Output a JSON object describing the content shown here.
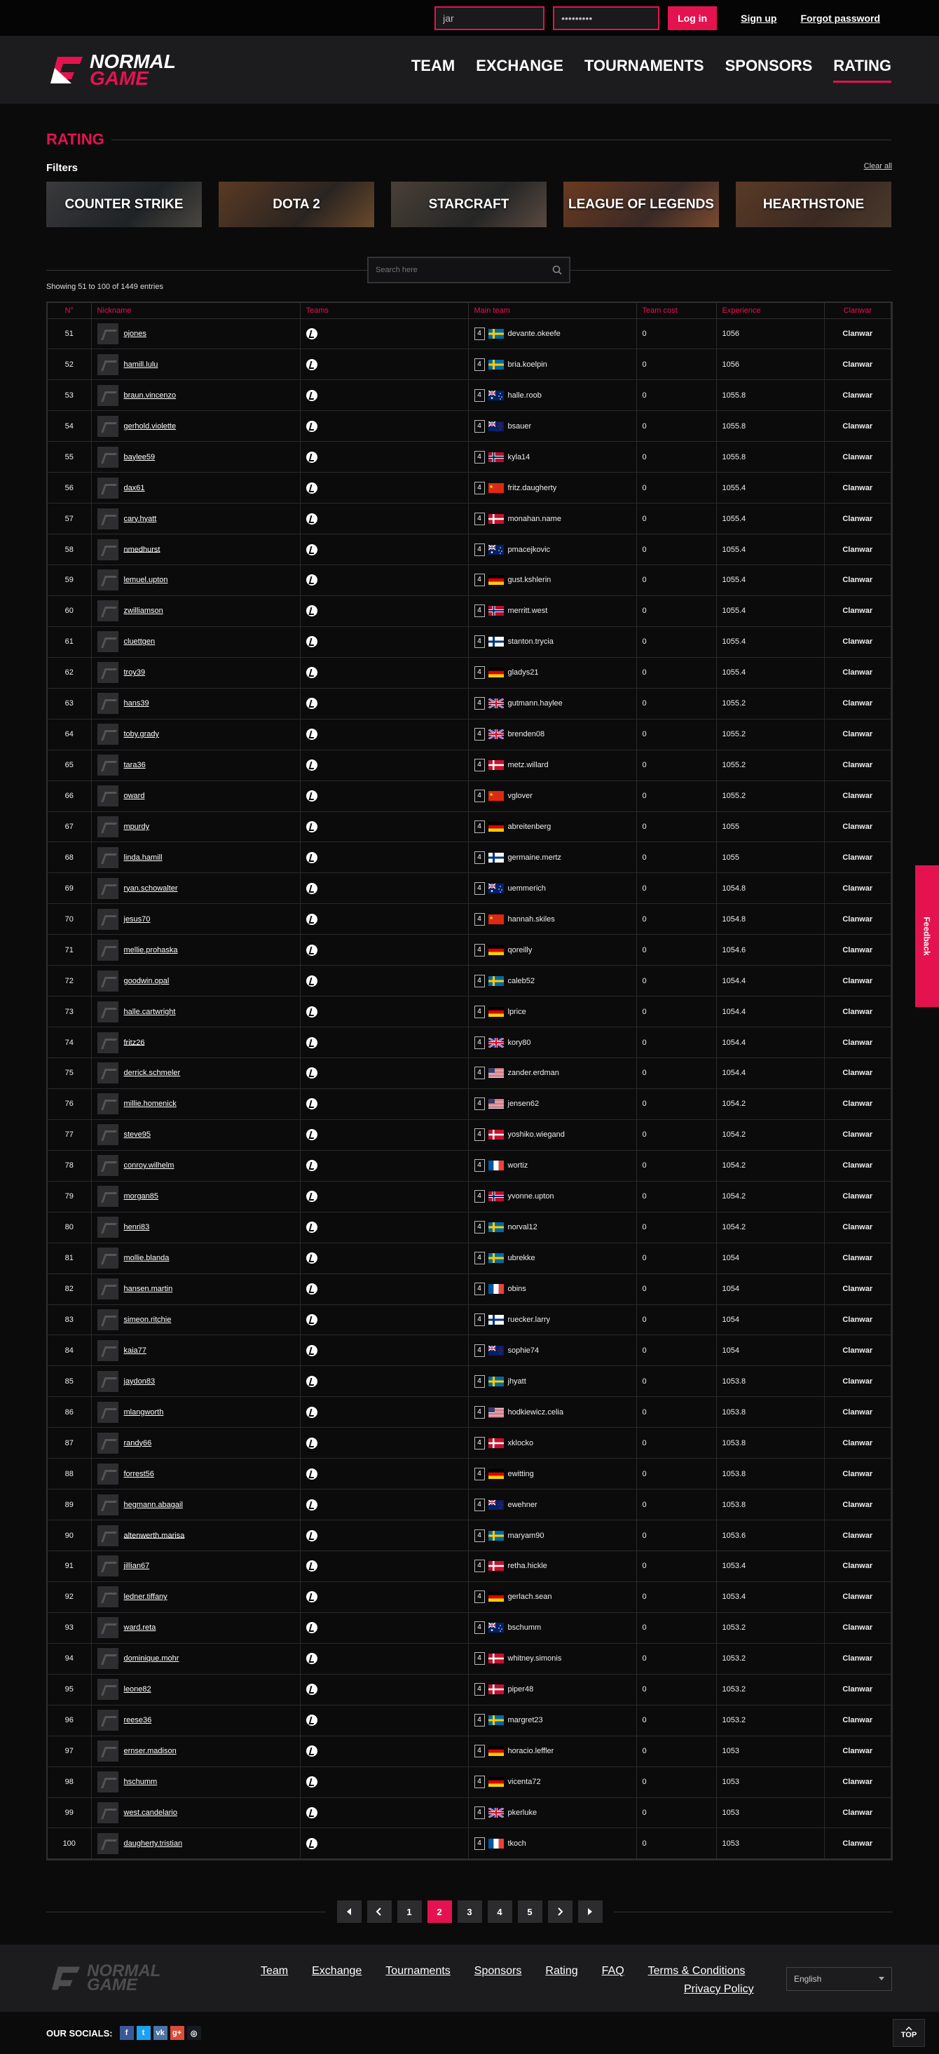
{
  "topbar": {
    "login_value": "jar",
    "password_value": "•••••••••",
    "login_button": "Log in",
    "signup_link": "Sign up",
    "forgot_link": "Forgot password"
  },
  "header": {
    "logo_line1": "NORMAL",
    "logo_line2": "GAME",
    "nav": [
      "TEAM",
      "EXCHANGE",
      "TOURNAMENTS",
      "SPONSORS",
      "RATING"
    ],
    "active_nav": "RATING"
  },
  "page": {
    "title": "RATING",
    "filters_label": "Filters",
    "clear_all": "Clear all",
    "filters": [
      "COUNTER STRIKE",
      "DOTA 2",
      "STARCRAFT",
      "LEAGUE OF LEGENDS",
      "HEARTHSTONE"
    ],
    "search_placeholder": "Search here",
    "showing": "Showing 51 to 100 of 1449 entries"
  },
  "table": {
    "headers": [
      "N°",
      "Nickname",
      "Teams",
      "Main team",
      "Team cost",
      "Experience",
      "Clanwar"
    ],
    "team_badge": "4",
    "clanwar_label": "Clanwar",
    "rows": [
      [
        "51",
        "ojones",
        "devante.okeefe",
        "se",
        "0",
        "1056"
      ],
      [
        "52",
        "hamill.lulu",
        "bria.koelpin",
        "se",
        "0",
        "1056"
      ],
      [
        "53",
        "braun.vincenzo",
        "halle.roob",
        "au",
        "0",
        "1055.8"
      ],
      [
        "54",
        "gerhold.violette",
        "bsauer",
        "nz",
        "0",
        "1055.8"
      ],
      [
        "55",
        "baylee59",
        "kyla14",
        "no",
        "0",
        "1055.8"
      ],
      [
        "56",
        "dax61",
        "fritz.daugherty",
        "cn",
        "0",
        "1055.4"
      ],
      [
        "57",
        "cary.hyatt",
        "monahan.name",
        "dk",
        "0",
        "1055.4"
      ],
      [
        "58",
        "nmedhurst",
        "pmacejkovic",
        "au",
        "0",
        "1055.4"
      ],
      [
        "59",
        "lemuel.upton",
        "gust.kshlerin",
        "de",
        "0",
        "1055.4"
      ],
      [
        "60",
        "zwilliamson",
        "merritt.west",
        "no",
        "0",
        "1055.4"
      ],
      [
        "61",
        "cluettgen",
        "stanton.trycia",
        "fi",
        "0",
        "1055.4"
      ],
      [
        "62",
        "troy39",
        "gladys21",
        "de",
        "0",
        "1055.4"
      ],
      [
        "63",
        "hans39",
        "gutmann.haylee",
        "gb",
        "0",
        "1055.2"
      ],
      [
        "64",
        "toby.grady",
        "brenden08",
        "gb",
        "0",
        "1055.2"
      ],
      [
        "65",
        "tara36",
        "metz.willard",
        "dk",
        "0",
        "1055.2"
      ],
      [
        "66",
        "oward",
        "vglover",
        "cn",
        "0",
        "1055.2"
      ],
      [
        "67",
        "mpurdy",
        "abreitenberg",
        "de",
        "0",
        "1055"
      ],
      [
        "68",
        "linda.hamill",
        "germaine.mertz",
        "fi",
        "0",
        "1055"
      ],
      [
        "69",
        "ryan.schowalter",
        "uemmerich",
        "au",
        "0",
        "1054.8"
      ],
      [
        "70",
        "jesus70",
        "hannah.skiles",
        "cn",
        "0",
        "1054.8"
      ],
      [
        "71",
        "mellie.prohaska",
        "qoreilly",
        "de",
        "0",
        "1054.6"
      ],
      [
        "72",
        "goodwin.opal",
        "caleb52",
        "se",
        "0",
        "1054.4"
      ],
      [
        "73",
        "halle.cartwright",
        "lprice",
        "de",
        "0",
        "1054.4"
      ],
      [
        "74",
        "fritz26",
        "kory80",
        "gb",
        "0",
        "1054.4"
      ],
      [
        "75",
        "derrick.schmeler",
        "zander.erdman",
        "us",
        "0",
        "1054.4"
      ],
      [
        "76",
        "millie.homenick",
        "jensen62",
        "us",
        "0",
        "1054.2"
      ],
      [
        "77",
        "steve95",
        "yoshiko.wiegand",
        "dk",
        "0",
        "1054.2"
      ],
      [
        "78",
        "conroy.wilhelm",
        "wortiz",
        "fr",
        "0",
        "1054.2"
      ],
      [
        "79",
        "morgan85",
        "yvonne.upton",
        "no",
        "0",
        "1054.2"
      ],
      [
        "80",
        "henri83",
        "norval12",
        "se",
        "0",
        "1054.2"
      ],
      [
        "81",
        "mollie.blanda",
        "ubrekke",
        "se",
        "0",
        "1054"
      ],
      [
        "82",
        "hansen.martin",
        "obins",
        "fr",
        "0",
        "1054"
      ],
      [
        "83",
        "simeon.ritchie",
        "ruecker.larry",
        "fi",
        "0",
        "1054"
      ],
      [
        "84",
        "kaia77",
        "sophie74",
        "nz",
        "0",
        "1054"
      ],
      [
        "85",
        "jaydon83",
        "jhyatt",
        "se",
        "0",
        "1053.8"
      ],
      [
        "86",
        "mlangworth",
        "hodkiewicz.celia",
        "us",
        "0",
        "1053.8"
      ],
      [
        "87",
        "randy66",
        "xklocko",
        "dk",
        "0",
        "1053.8"
      ],
      [
        "88",
        "forrest56",
        "ewitting",
        "de",
        "0",
        "1053.8"
      ],
      [
        "89",
        "hegmann.abagail",
        "ewehner",
        "nz",
        "0",
        "1053.8"
      ],
      [
        "90",
        "altenwerth.marisa",
        "maryam90",
        "se",
        "0",
        "1053.6"
      ],
      [
        "91",
        "jillian67",
        "retha.hickle",
        "dk",
        "0",
        "1053.4"
      ],
      [
        "92",
        "ledner.tiffany",
        "gerlach.sean",
        "de",
        "0",
        "1053.4"
      ],
      [
        "93",
        "ward.reta",
        "bschumm",
        "au",
        "0",
        "1053.2"
      ],
      [
        "94",
        "dominique.mohr",
        "whitney.simonis",
        "dk",
        "0",
        "1053.2"
      ],
      [
        "95",
        "leone82",
        "piper48",
        "dk",
        "0",
        "1053.2"
      ],
      [
        "96",
        "reese36",
        "margret23",
        "se",
        "0",
        "1053.2"
      ],
      [
        "97",
        "ernser.madison",
        "horacio.leffler",
        "de",
        "0",
        "1053"
      ],
      [
        "98",
        "hschumm",
        "vicenta72",
        "de",
        "0",
        "1053"
      ],
      [
        "99",
        "west.candelario",
        "pkerluke",
        "gb",
        "0",
        "1053"
      ],
      [
        "100",
        "daugherty.tristian",
        "tkoch",
        "fr",
        "0",
        "1053"
      ]
    ]
  },
  "pagination": {
    "pages": [
      "1",
      "2",
      "3",
      "4",
      "5"
    ],
    "active": "2"
  },
  "footer": {
    "logo_line1": "NORMAL",
    "logo_line2": "GAME",
    "links": [
      "Team",
      "Exchange",
      "Tournaments",
      "Sponsors",
      "Rating",
      "FAQ",
      "Terms & Conditions"
    ],
    "privacy": "Privacy Policy",
    "language": "English",
    "socials_label": "OUR SOCIALS:",
    "top_label": "TOP",
    "feedback": "Feedback"
  },
  "colors": {
    "accent": "#e4134f",
    "background": "#0b0b0c",
    "panel": "#1c1c1f"
  }
}
